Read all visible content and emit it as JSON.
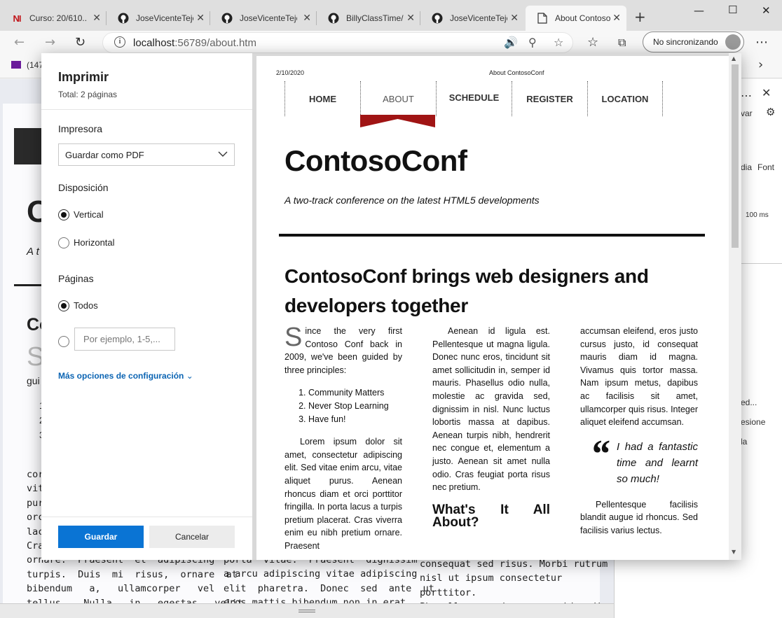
{
  "tabs": [
    {
      "title": "Curso: 20/610...",
      "icon": "ni-logo-icon",
      "favtext": "NI"
    },
    {
      "title": "JoseVicenteTeje",
      "icon": "github-icon"
    },
    {
      "title": "JoseVicenteTeje",
      "icon": "github-icon"
    },
    {
      "title": "BillyClassTime/",
      "icon": "github-icon"
    },
    {
      "title": "JoseVicenteTeje",
      "icon": "github-icon"
    },
    {
      "title": "About Contoso",
      "icon": "page-icon",
      "active": true
    }
  ],
  "address": {
    "host": "localhost",
    "path": ":56789/about.htm"
  },
  "sync_label": "No sincronizando",
  "favorites": {
    "mail_label": "(147"
  },
  "devtools_fragments": {
    "a": "var",
    "b": "dia",
    "c": "Font",
    "d": "100 ms",
    "e": "ed...",
    "f": "esione",
    "g": "la"
  },
  "background_page": {
    "big_letter": "C",
    "tag_frag": "A t",
    "h2_frag": "Co",
    "s_frag": "S",
    "gui": "gui",
    "list_nums": [
      "1",
      "2",
      "3"
    ],
    "col1": [
      "cor",
      "vita",
      "pur",
      "orc",
      "lacu",
      "Cra",
      "ornare.  Praesent  et  adipiscing",
      "turpis.  Duis  mi  risus,  ornare  at",
      "bibendum   a,   ullamcorper   vel",
      "tellus.   Nulla   in   egestas   velit"
    ],
    "col2": [
      "porta  vitae.  Praesent  dignissim",
      "a arcu adipiscing vitae adipiscing",
      "elit  pharetra.  Donec  sed  ante  ut",
      "eros mattis bibendum non in erat."
    ],
    "col3": [
      "consequat sed risus. Morbi rutrum",
      "nisl ut ipsum consectetur porttitor.",
      "Phasellus   sed   nunc   id   diam"
    ]
  },
  "print": {
    "title": "Imprimir",
    "total": "Total: 2 páginas",
    "printer_label": "Impresora",
    "printer_value": "Guardar como PDF",
    "layout_label": "Disposición",
    "layout_options": [
      "Vertical",
      "Horizontal"
    ],
    "layout_selected": "Vertical",
    "pages_label": "Páginas",
    "pages_all": "Todos",
    "pages_placeholder": "Por ejemplo, 1-5,...",
    "more_options": "Más opciones de configuración",
    "save": "Guardar",
    "cancel": "Cancelar"
  },
  "preview": {
    "date": "2/10/2020",
    "doc_title": "About ContosoConf",
    "nav": [
      "HOME",
      "ABOUT",
      "SCHEDULE",
      "REGISTER",
      "LOCATION"
    ],
    "nav_active": "ABOUT",
    "accent": "#a01414",
    "h1": "ContosoConf",
    "tagline": "A two-track conference on the latest HTML5 developments",
    "h2": "ContosoConf brings web designers and developers together",
    "col1": {
      "dropcap": "S",
      "intro": "ince the very first Contoso Conf back in 2009, we've been guided by three principles:",
      "principles": [
        "Community Matters",
        "Never Stop Learning",
        "Have fun!"
      ],
      "para": "Lorem ipsum dolor sit amet, consectetur adipiscing elit. Sed vitae enim arcu, vitae aliquet purus. Aenean rhoncus diam et orci porttitor fringilla. In porta lacus a turpis pretium placerat. Cras viverra enim eu nibh pretium ornare. Praesent"
    },
    "col2": {
      "para": "Aenean id ligula est. Pellentesque ut magna ligula. Donec nunc eros, tincidunt sit amet sollicitudin in, semper id mauris. Phasellus odio nulla, molestie ac gravida sed, dignissim in nisl. Nunc luctus lobortis massa at dapibus. Aenean turpis nibh, hendrerit nec congue et, elementum a justo. Aenean sit amet nulla odio. Cras feugiat porta risus nec pretium.",
      "heading": "What's It All About?"
    },
    "col3": {
      "para": "accumsan eleifend, eros justo cursus justo, id consequat mauris diam id magna. Vivamus quis tortor massa. Nam ipsum metus, dapibus ac facilisis sit amet, ullamcorper quis risus. Integer aliquet eleifend accumsan.",
      "quote": "I had a fantastic time and learnt so much!",
      "para2": "Pellentesque facilisis blandit augue id rhoncus. Sed facilisis varius lectus."
    }
  }
}
